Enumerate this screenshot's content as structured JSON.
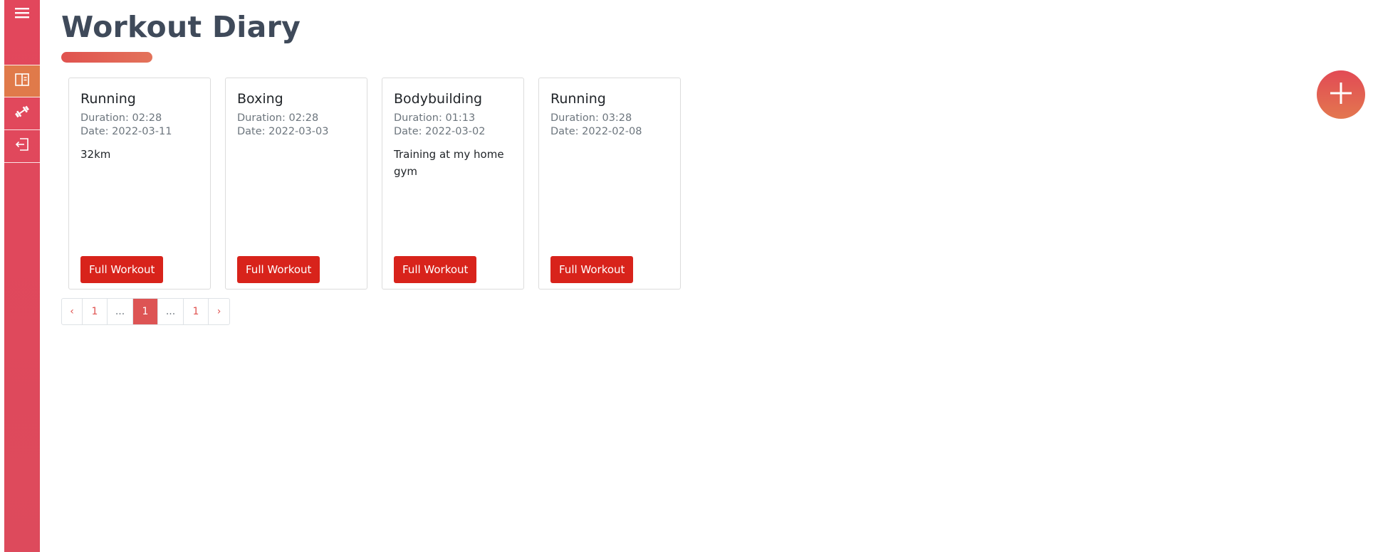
{
  "page": {
    "title": "Workout Diary"
  },
  "sidebar": {
    "items": [
      {
        "icon": "menu-icon"
      },
      {
        "icon": "diary-icon",
        "active": true
      },
      {
        "icon": "dumbbell-icon"
      },
      {
        "icon": "logout-icon"
      }
    ]
  },
  "workouts": [
    {
      "title": "Running",
      "duration": "Duration: 02:28",
      "date": "Date: 2022-03-11",
      "note": "32km",
      "button": "Full Workout"
    },
    {
      "title": "Boxing",
      "duration": "Duration: 02:28",
      "date": "Date: 2022-03-03",
      "note": "",
      "button": "Full Workout"
    },
    {
      "title": "Bodybuilding",
      "duration": "Duration: 01:13",
      "date": "Date: 2022-03-02",
      "note": "Training at my home gym",
      "button": "Full Workout"
    },
    {
      "title": "Running",
      "duration": "Duration: 03:28",
      "date": "Date: 2022-02-08",
      "note": "",
      "button": "Full Workout"
    }
  ],
  "pagination": {
    "prev": "‹",
    "first": "1",
    "ellipsis_left": "...",
    "current": "1",
    "ellipsis_right": "...",
    "last": "1",
    "next": "›"
  },
  "fab": {
    "icon": "plus-icon"
  },
  "colors": {
    "sidebar": "#e2475c",
    "sidebar_active": "#e07a4a",
    "button": "#d8231b",
    "accent": "#e0524f",
    "title": "#3f4a5a"
  }
}
